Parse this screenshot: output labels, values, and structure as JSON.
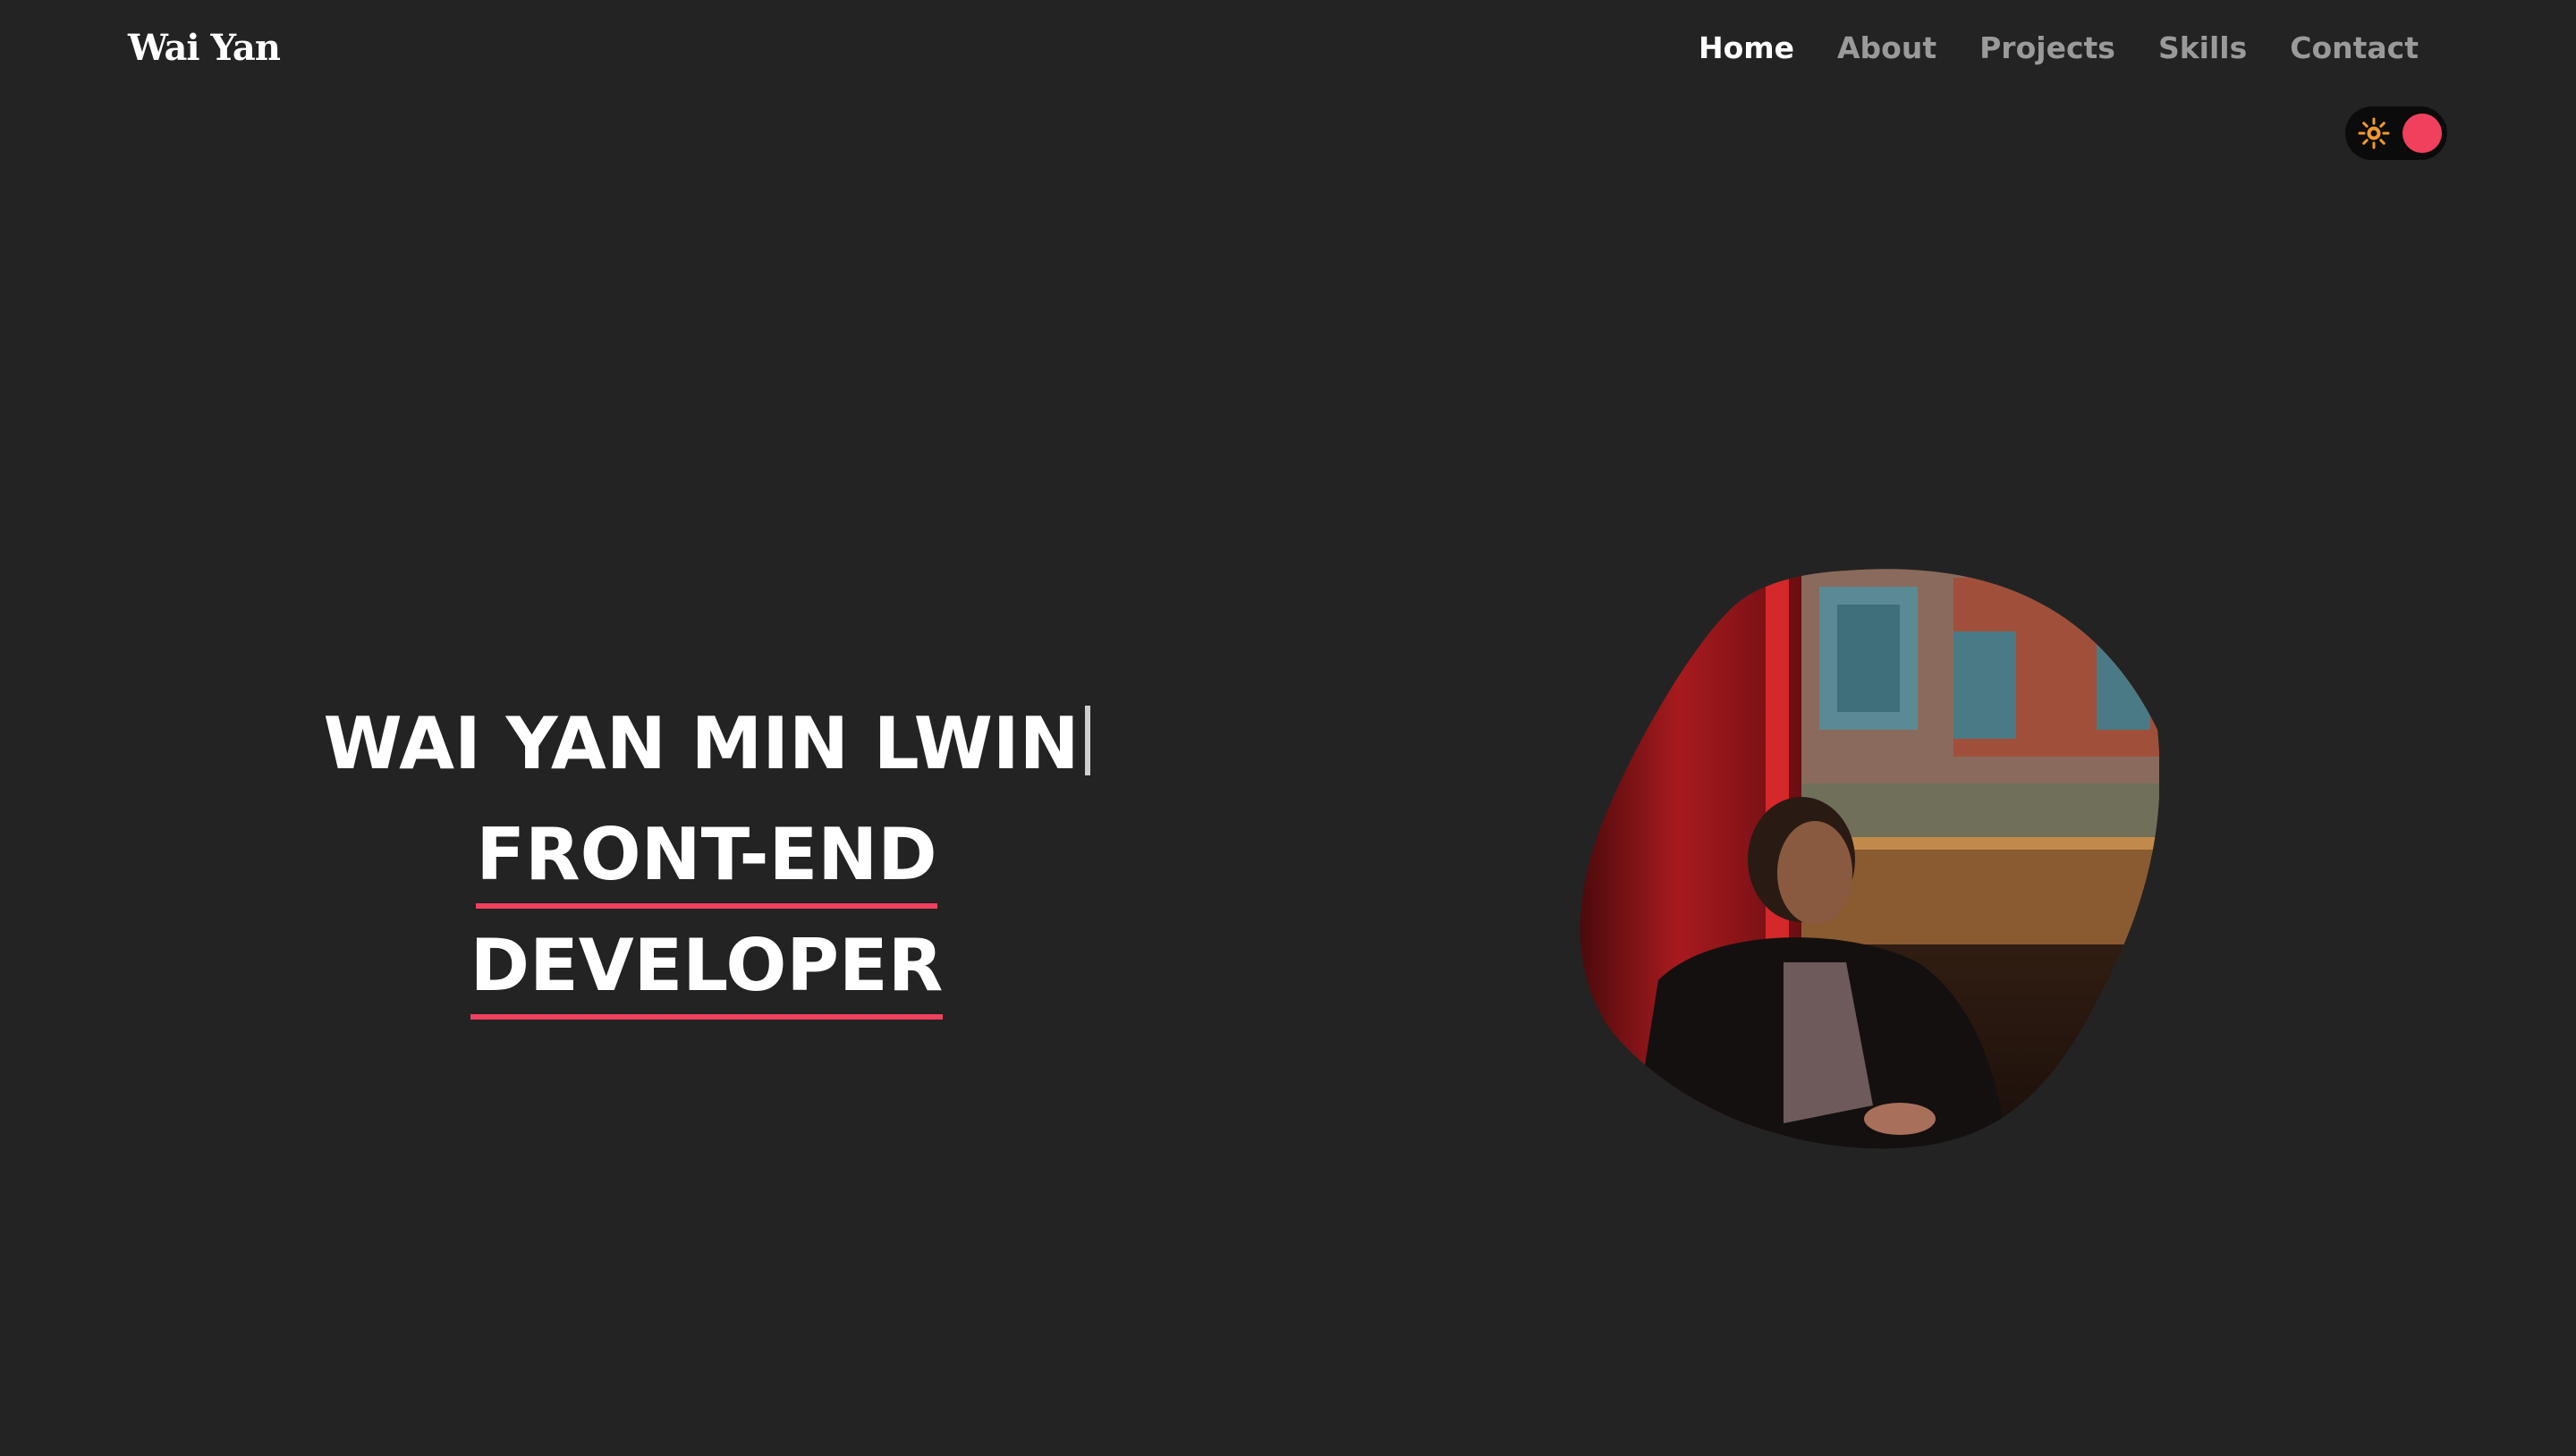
{
  "header": {
    "logo": "Wai Yan",
    "nav": [
      {
        "label": "Home",
        "active": true
      },
      {
        "label": "About",
        "active": false
      },
      {
        "label": "Projects",
        "active": false
      },
      {
        "label": "Skills",
        "active": false
      },
      {
        "label": "Contact",
        "active": false
      }
    ]
  },
  "theme_toggle": {
    "icon": "sun-icon",
    "accent_color": "#f0405e",
    "sun_color": "#f29a2e"
  },
  "hero": {
    "name": "WAI YAN MIN LWIN",
    "role_line1": "FRONT-END",
    "role_line2": "DEVELOPER",
    "portrait": "portrait-photo"
  },
  "colors": {
    "background": "#232323",
    "accent": "#f0405e",
    "nav_inactive": "#9a9a9a",
    "text": "#ffffff"
  }
}
